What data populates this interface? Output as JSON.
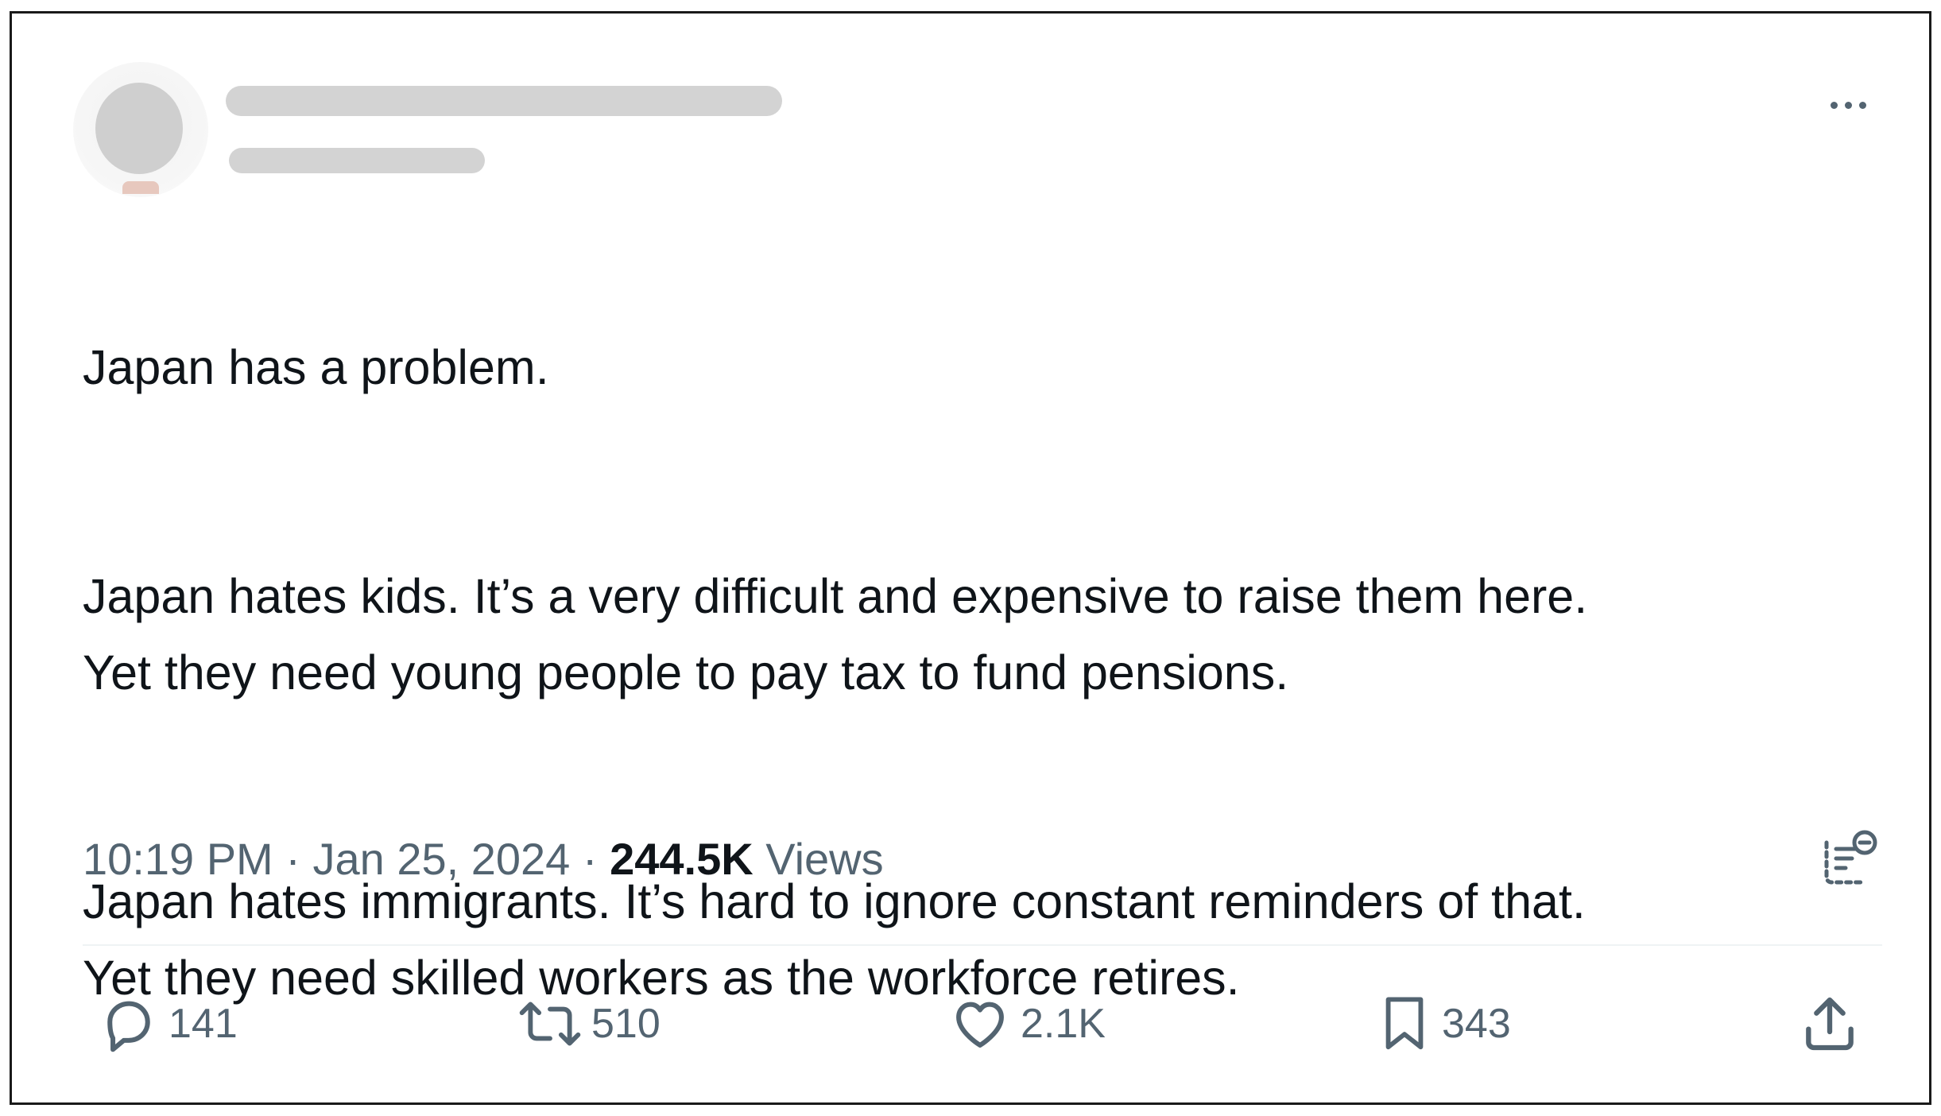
{
  "tweet": {
    "author": {
      "display_name": "",
      "handle": ""
    },
    "paragraphs": [
      "Japan has a problem.",
      "Japan hates kids. It’s a very difficult and expensive to raise them here.\nYet they need young people to pay tax to fund pensions.",
      "Japan hates immigrants. It’s hard to ignore constant reminders of that.\nYet they need skilled workers as the workforce retires."
    ],
    "time": "10:19 PM",
    "date": "Jan 25, 2024",
    "separator": "·",
    "views_count": "244.5K",
    "views_label": "Views"
  },
  "actions": {
    "reply_count": "141",
    "repost_count": "510",
    "like_count": "2.1K",
    "bookmark_count": "343"
  },
  "icons": {
    "more": "more-horizontal-icon",
    "analytics": "post-analytics-icon",
    "reply": "reply-icon",
    "repost": "repost-icon",
    "like": "heart-icon",
    "bookmark": "bookmark-icon",
    "share": "share-icon"
  },
  "colors": {
    "text_primary": "#0f1419",
    "text_secondary": "#536471",
    "divider": "#eff3f4",
    "redaction": "#d3d3d3"
  }
}
